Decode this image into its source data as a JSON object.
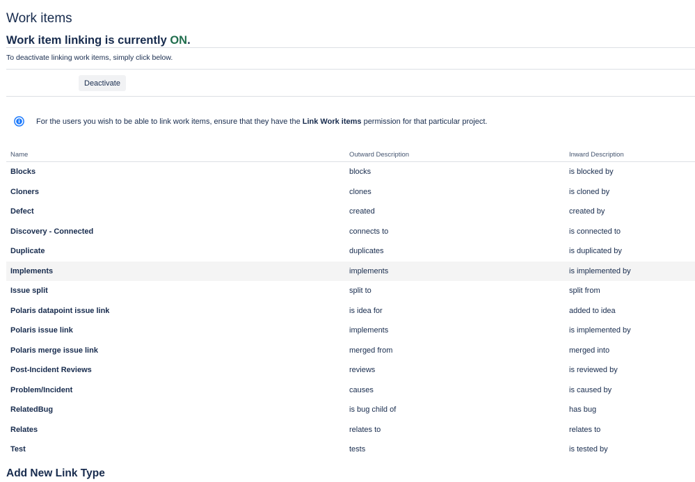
{
  "page": {
    "title": "Work items"
  },
  "status": {
    "prefix": "Work item linking is currently ",
    "state": "ON",
    "suffix": "."
  },
  "deactivate": {
    "help": "To deactivate linking work items, simply click below.",
    "button_label": "Deactivate"
  },
  "info": {
    "text_before": "For the users you wish to be able to link work items, ensure that they have the ",
    "permission": "Link Work items",
    "text_after": " permission for that particular project."
  },
  "table": {
    "headers": {
      "name": "Name",
      "outward": "Outward Description",
      "inward": "Inward Description"
    },
    "rows": [
      {
        "name": "Blocks",
        "outward": "blocks",
        "inward": "is blocked by"
      },
      {
        "name": "Cloners",
        "outward": "clones",
        "inward": "is cloned by"
      },
      {
        "name": "Defect",
        "outward": "created",
        "inward": "created by"
      },
      {
        "name": "Discovery - Connected",
        "outward": "connects to",
        "inward": "is connected to"
      },
      {
        "name": "Duplicate",
        "outward": "duplicates",
        "inward": "is duplicated by"
      },
      {
        "name": "Implements",
        "outward": "implements",
        "inward": "is implemented by"
      },
      {
        "name": "Issue split",
        "outward": "split to",
        "inward": "split from"
      },
      {
        "name": "Polaris datapoint issue link",
        "outward": "is idea for",
        "inward": "added to idea"
      },
      {
        "name": "Polaris issue link",
        "outward": "implements",
        "inward": "is implemented by"
      },
      {
        "name": "Polaris merge issue link",
        "outward": "merged from",
        "inward": "merged into"
      },
      {
        "name": "Post-Incident Reviews",
        "outward": "reviews",
        "inward": "is reviewed by"
      },
      {
        "name": "Problem/Incident",
        "outward": "causes",
        "inward": "is caused by"
      },
      {
        "name": "RelatedBug",
        "outward": "is bug child of",
        "inward": "has bug"
      },
      {
        "name": "Relates",
        "outward": "relates to",
        "inward": "relates to"
      },
      {
        "name": "Test",
        "outward": "tests",
        "inward": "is tested by"
      }
    ]
  },
  "add_section": {
    "title": "Add New Link Type"
  },
  "colors": {
    "accent_on": "#216e4e",
    "info_icon": "#1d7afc",
    "text": "#172b4d",
    "row_highlight": "#f4f4f4"
  },
  "icons": {
    "info": "info-icon"
  }
}
